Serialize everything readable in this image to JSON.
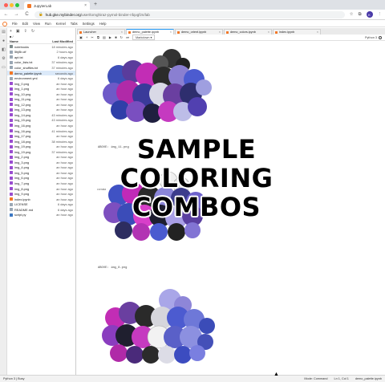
{
  "browser": {
    "tab_title": "JupyterLab",
    "tab_close": "×",
    "new_tab": "+",
    "back": "←",
    "forward": "→",
    "reload": "C",
    "url_host": "hub.gke.mybinder.org",
    "url_path": "/user/tomghiraz-pymol-binder-nfqvgfzn/lab",
    "avatar": "K"
  },
  "menu": [
    "File",
    "Edit",
    "View",
    "Run",
    "Kernel",
    "Tabs",
    "Settings",
    "Help"
  ],
  "filebrowser": {
    "path": "■ /",
    "columns": {
      "name": "Name",
      "modified": "Last Modified"
    },
    "files": [
      {
        "name": "notebooks",
        "modified": "18 minutes ago",
        "type": "folder"
      },
      {
        "name": "5bj8b.cif",
        "modified": "2 hours ago",
        "type": "file"
      },
      {
        "name": "apt.txt",
        "modified": "6 days ago",
        "type": "file"
      },
      {
        "name": "color_lists.txt",
        "modified": "37 minutes ago",
        "type": "file"
      },
      {
        "name": "color_shuffles.txt",
        "modified": "37 minutes ago",
        "type": "file"
      },
      {
        "name": "demo_palette.ipynb",
        "modified": "seconds ago",
        "type": "notebook",
        "selected": true
      },
      {
        "name": "environment.yml",
        "modified": "6 days ago",
        "type": "file"
      },
      {
        "name": "img_0.png",
        "modified": "an hour ago",
        "type": "image"
      },
      {
        "name": "img_1.png",
        "modified": "an hour ago",
        "type": "image"
      },
      {
        "name": "img_10.png",
        "modified": "an hour ago",
        "type": "image"
      },
      {
        "name": "img_11.png",
        "modified": "an hour ago",
        "type": "image"
      },
      {
        "name": "img_12.png",
        "modified": "an hour ago",
        "type": "image"
      },
      {
        "name": "img_13.png",
        "modified": "an hour ago",
        "type": "image"
      },
      {
        "name": "img_14.png",
        "modified": "43 minutes ago",
        "type": "image"
      },
      {
        "name": "img_15.png",
        "modified": "43 minutes ago",
        "type": "image"
      },
      {
        "name": "img_16.png",
        "modified": "an hour ago",
        "type": "image"
      },
      {
        "name": "img_16.png",
        "modified": "41 minutes ago",
        "type": "image"
      },
      {
        "name": "img_17.png",
        "modified": "an hour ago",
        "type": "image"
      },
      {
        "name": "img_18.png",
        "modified": "38 minutes ago",
        "type": "image"
      },
      {
        "name": "img_19.png",
        "modified": "an hour ago",
        "type": "image"
      },
      {
        "name": "img_19.png",
        "modified": "37 minutes ago",
        "type": "image"
      },
      {
        "name": "img_2.png",
        "modified": "an hour ago",
        "type": "image"
      },
      {
        "name": "img_3.png",
        "modified": "an hour ago",
        "type": "image"
      },
      {
        "name": "img_4.png",
        "modified": "an hour ago",
        "type": "image"
      },
      {
        "name": "img_5.png",
        "modified": "an hour ago",
        "type": "image"
      },
      {
        "name": "img_6.png",
        "modified": "an hour ago",
        "type": "image"
      },
      {
        "name": "img_7.png",
        "modified": "an hour ago",
        "type": "image"
      },
      {
        "name": "img_8.png",
        "modified": "an hour ago",
        "type": "image"
      },
      {
        "name": "img_9.png",
        "modified": "an hour ago",
        "type": "image"
      },
      {
        "name": "index.ipynb",
        "modified": "an hour ago",
        "type": "notebook"
      },
      {
        "name": "LICENSE",
        "modified": "6 days ago",
        "type": "file"
      },
      {
        "name": "README.md",
        "modified": "6 days ago",
        "type": "file"
      },
      {
        "name": "script.py",
        "modified": "an hour ago",
        "type": "python"
      }
    ]
  },
  "doc_tabs": [
    {
      "title": "Launcher",
      "active": false
    },
    {
      "title": "demo_palette.ipynb",
      "active": true
    },
    {
      "title": "demo_orient.ipynb",
      "active": false
    },
    {
      "title": "demo_colors.ipynb",
      "active": false
    },
    {
      "title": "index.ipynb",
      "active": false
    }
  ],
  "nb_toolbar": {
    "cell_type": "Markdown ▾",
    "kernel": "Python 3"
  },
  "outputs": [
    {
      "prompt": "ABOVE:  img_11.png"
    },
    {
      "prompt": "ABOVE:  img_8.png"
    }
  ],
  "side_text": "cornaia",
  "overlay": {
    "line1": "SAMPLE",
    "line2": "COLORING",
    "line3": "COMBOS"
  },
  "statusbar": {
    "left": "Python 3 | Busy",
    "mode": "Mode: Command",
    "position": "Ln 1, Col 1",
    "file": "demo_palette.ipynb"
  },
  "colors": {
    "accent": "#2196f3",
    "jupyter_orange": "#f37726",
    "protein_purple": "#6a3fa0",
    "protein_magenta": "#c02ab8",
    "protein_blue": "#4b5fc8"
  }
}
